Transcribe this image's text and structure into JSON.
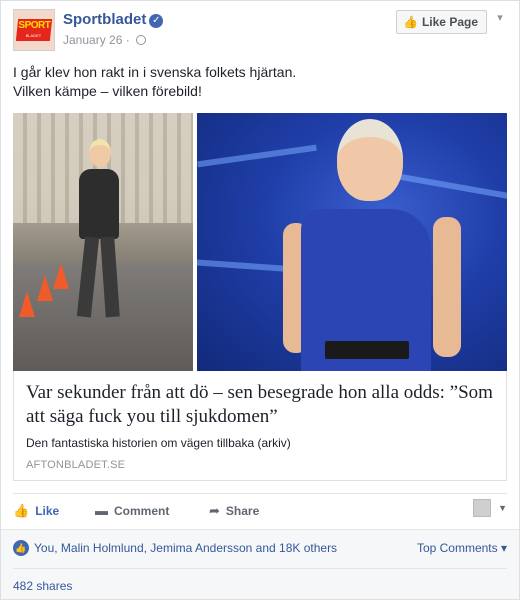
{
  "post": {
    "page_name": "Sportbladet",
    "date": "January 26",
    "separator": "·",
    "like_page_label": "Like Page",
    "text_line1": "I går klev hon rakt in i svenska folkets hjärtan.",
    "text_line2": "Vilken kämpe – vilken förebild!",
    "logo_text": "SPORT",
    "logo_subtext": "BLADET"
  },
  "link": {
    "title": "Var sekunder från att dö – sen besegrade hon alla odds: ”Som att säga fuck you till sjukdomen”",
    "description": "Den fantastiska historien om vägen tillbaka (arkiv)",
    "domain": "AFTONBLADET.SE"
  },
  "actions": {
    "like": "Like",
    "comment": "Comment",
    "share": "Share"
  },
  "engagement": {
    "reactions": "You, Malin Holmlund, Jemima Andersson and 18K others",
    "top_comments": "Top Comments",
    "shares": "482 shares"
  },
  "icons": {
    "verified": "verified-check-icon",
    "globe": "globe-icon",
    "thumb": "thumbs-up-icon",
    "comment": "comment-icon",
    "share": "share-arrow-icon",
    "chevron": "chevron-down-icon"
  },
  "colors": {
    "brand_blue": "#4267b2",
    "link_blue": "#365899",
    "muted": "#90949c",
    "logo_red": "#e4261b",
    "logo_yellow": "#ffde00"
  }
}
